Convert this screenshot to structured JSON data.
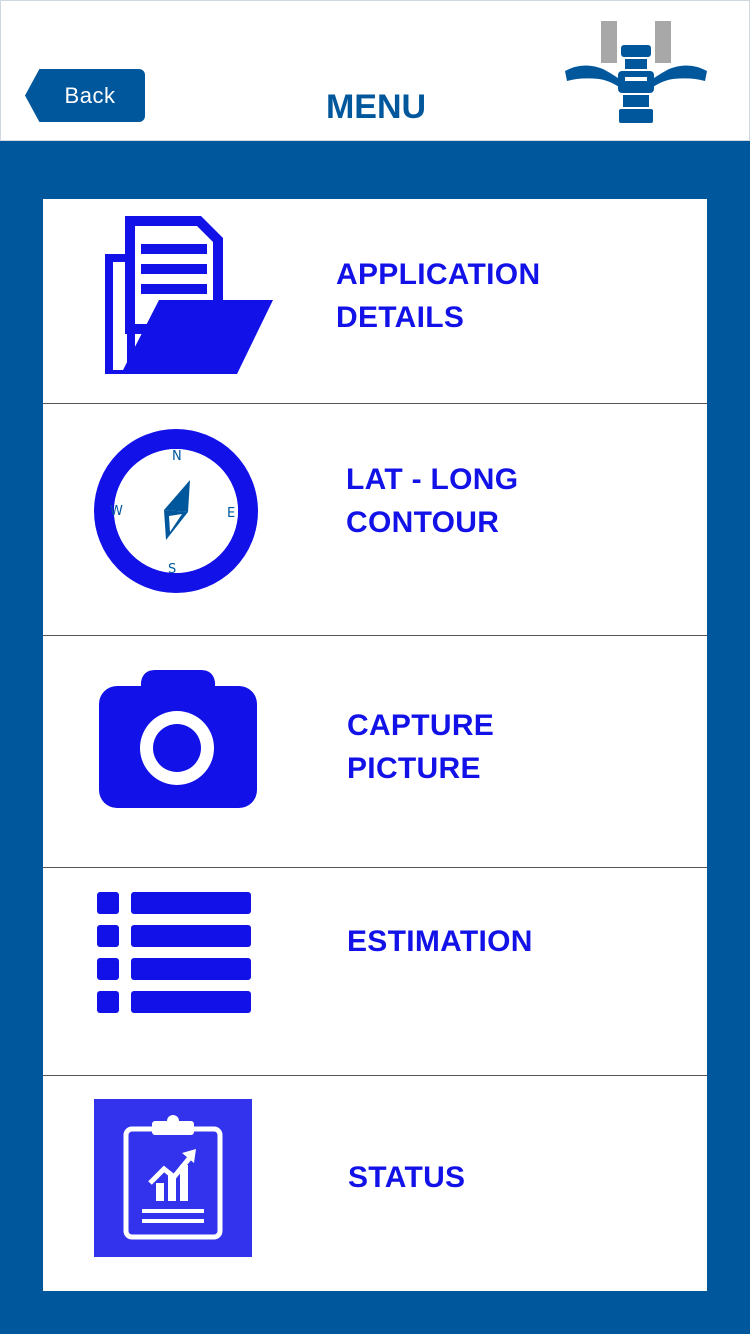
{
  "header": {
    "back_label": "Back",
    "title": "MENU",
    "logo_icon": "organization-logo"
  },
  "menu": {
    "items": [
      {
        "id": "application-details",
        "label": "APPLICATION\nDETAILS",
        "icon": "folder-document-icon"
      },
      {
        "id": "lat-long-contour",
        "label": "LAT - LONG\nCONTOUR",
        "icon": "compass-icon",
        "compass_letters": {
          "n": "N",
          "e": "E",
          "s": "S",
          "w": "W"
        }
      },
      {
        "id": "capture-picture",
        "label": "CAPTURE\nPICTURE",
        "icon": "camera-icon"
      },
      {
        "id": "estimation",
        "label": "ESTIMATION",
        "icon": "list-icon"
      },
      {
        "id": "status",
        "label": "STATUS",
        "icon": "clipboard-chart-icon"
      }
    ]
  },
  "colors": {
    "primary": "#00579c",
    "accent_blue": "#1212e8",
    "status_tile": "#3333ee"
  }
}
